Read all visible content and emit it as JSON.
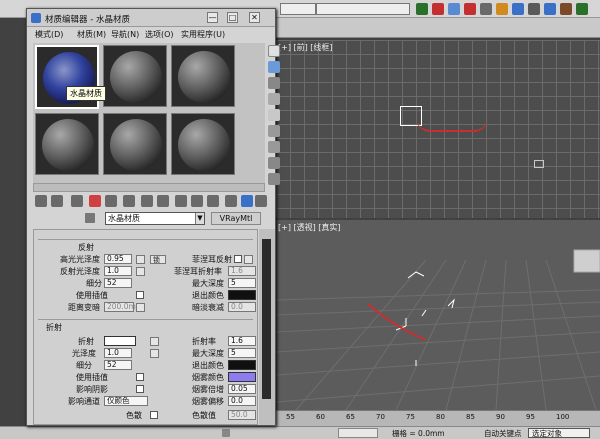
{
  "window": {
    "title": "材质编辑器 - 水晶材质",
    "menus": [
      "模式(D)",
      "材质(M)",
      "导航(N)",
      "选项(O)",
      "实用程序(U)"
    ],
    "min_label": "—",
    "max_label": "□",
    "close_label": "✕"
  },
  "slots": {
    "tooltip": "水晶材质"
  },
  "material": {
    "name": "水晶材质",
    "type": "VRayMtl"
  },
  "reflection": {
    "group_label": "反射",
    "hilight_gloss": {
      "label": "高光光泽度",
      "value": "0.95"
    },
    "refl_gloss": {
      "label": "反射光泽度",
      "value": "1.0"
    },
    "subdivs": {
      "label": "细分",
      "value": "52"
    },
    "use_interp": "使用插值",
    "dim_distance": {
      "label": "距离变暗",
      "value": "200.0m"
    },
    "lock_label": "锁",
    "fresnel": "菲涅耳反射",
    "fresnel_ior": {
      "label": "菲涅耳折射率",
      "value": "1.6"
    },
    "max_depth": {
      "label": "最大深度",
      "value": "5"
    },
    "exit_color": "退出颜色",
    "dim_falloff": {
      "label": "暗淡衰减",
      "value": "0.0"
    }
  },
  "refraction": {
    "group_label": "折射",
    "refract": "折射",
    "glossiness": {
      "label": "光泽度",
      "value": "1.0"
    },
    "subdivs": {
      "label": "细分",
      "value": "52"
    },
    "use_interp": "使用插值",
    "affect_shadows": "影响阴影",
    "affect_channels": {
      "label": "影响通道",
      "value": "仅颜色"
    },
    "dispersion": "色散",
    "ior": {
      "label": "折射率",
      "value": "1.6"
    },
    "max_depth": {
      "label": "最大深度",
      "value": "5"
    },
    "exit_color": "退出颜色",
    "fog_color": "烟雾颜色",
    "fog_mult": {
      "label": "烟雾倍增",
      "value": "0.05"
    },
    "fog_bias": {
      "label": "烟雾偏移",
      "value": "0.0"
    },
    "abbe": {
      "label": "色散值",
      "value": "50.0"
    }
  },
  "viewports": {
    "top_label": "[+] [前] [线框]",
    "bottom_label": "[+] [透视] [真实]"
  },
  "timeline": {
    "ticks": [
      "55",
      "60",
      "65",
      "70",
      "75",
      "80",
      "85",
      "90",
      "95",
      "100"
    ]
  },
  "status": {
    "grid": "栅格 = 0.0mm",
    "autokey": "自动关键点",
    "selected": "选定对象"
  },
  "colors": {
    "refract_swatch": "#ffffff",
    "fog_swatch": "#8c7cf0",
    "exit_swatch": "#101010",
    "accent": "#3a70c8"
  }
}
